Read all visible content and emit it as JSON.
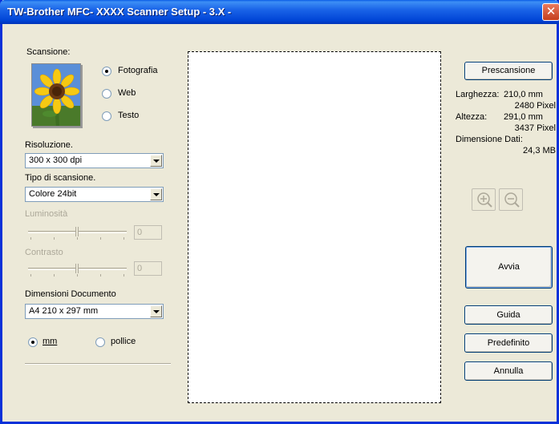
{
  "window": {
    "title": "TW-Brother MFC- XXXX Scanner Setup - 3.X -",
    "close_symbol": "✕"
  },
  "scan": {
    "label": "Scansione:",
    "options": [
      {
        "label": "Fotografia",
        "checked": true
      },
      {
        "label": "Web",
        "checked": false
      },
      {
        "label": "Testo",
        "checked": false
      }
    ]
  },
  "resolution": {
    "label": "Risoluzione.",
    "value": "300 x 300 dpi"
  },
  "scan_type": {
    "label": "Tipo di scansione.",
    "value": "Colore 24bit"
  },
  "brightness": {
    "label": "Luminosità",
    "value": "0"
  },
  "contrast": {
    "label": "Contrasto",
    "value": "0"
  },
  "doc_size": {
    "label": "Dimensioni Documento",
    "value": "A4 210 x 297 mm"
  },
  "units": [
    {
      "label": "mm",
      "checked": true
    },
    {
      "label": "pollice",
      "checked": false
    }
  ],
  "buttons": {
    "prescan": "Prescansione",
    "start": "Avvia",
    "help": "Guida",
    "default": "Predefinito",
    "cancel": "Annulla"
  },
  "info": {
    "width_label": "Larghezza:",
    "width_mm": "210,0 mm",
    "width_px": "2480 Pixel",
    "height_label": "Altezza:",
    "height_mm": "291,0 mm",
    "height_px": "3437 Pixel",
    "data_size_label": "Dimensione Dati:",
    "data_size": "24,3 MB"
  },
  "icons": [
    "sunflower-photo-icon",
    "zoom-in-icon",
    "zoom-out-icon",
    "close-icon"
  ]
}
